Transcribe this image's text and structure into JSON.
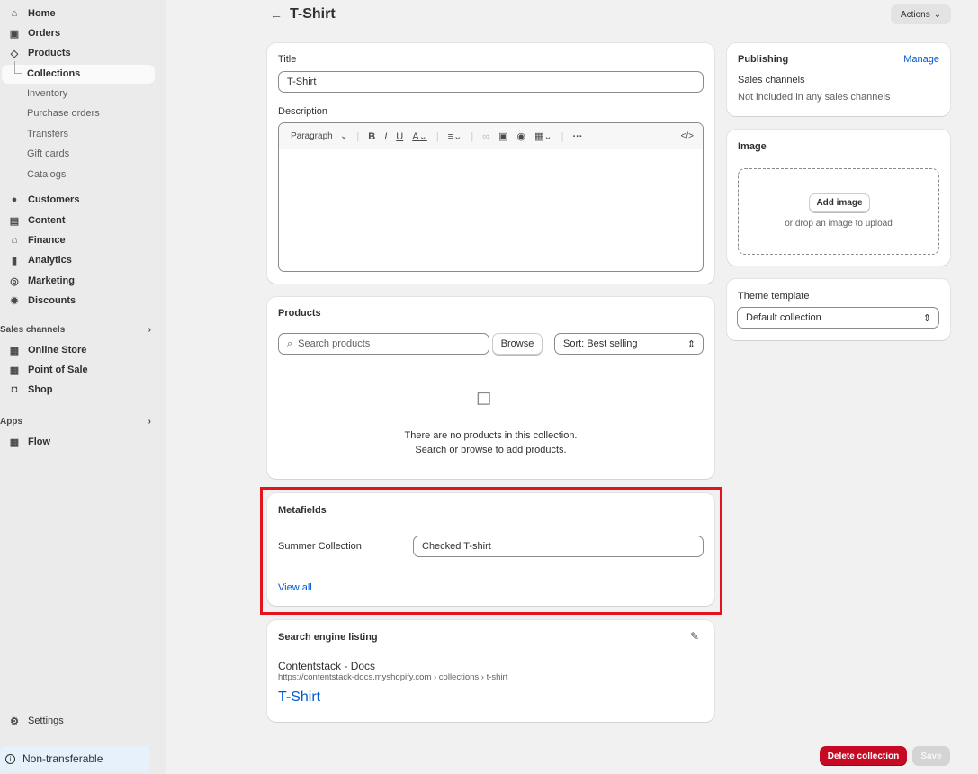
{
  "sidebar": {
    "main": [
      {
        "label": "Home",
        "icon": "home-icon"
      },
      {
        "label": "Orders",
        "icon": "inbox-icon"
      },
      {
        "label": "Products",
        "icon": "tag-icon"
      }
    ],
    "products_sub": [
      {
        "label": "Collections",
        "active": true
      },
      {
        "label": "Inventory"
      },
      {
        "label": "Purchase orders"
      },
      {
        "label": "Transfers"
      },
      {
        "label": "Gift cards"
      },
      {
        "label": "Catalogs"
      }
    ],
    "more": [
      {
        "label": "Customers",
        "icon": "person-icon"
      },
      {
        "label": "Content",
        "icon": "content-icon"
      },
      {
        "label": "Finance",
        "icon": "bank-icon"
      },
      {
        "label": "Analytics",
        "icon": "chart-icon"
      },
      {
        "label": "Marketing",
        "icon": "target-icon"
      },
      {
        "label": "Discounts",
        "icon": "discount-icon"
      }
    ],
    "sales_channels_label": "Sales channels",
    "channels": [
      {
        "label": "Online Store",
        "icon": "store-icon"
      },
      {
        "label": "Point of Sale",
        "icon": "pos-icon"
      },
      {
        "label": "Shop",
        "icon": "shop-icon"
      }
    ],
    "apps_label": "Apps",
    "apps": [
      {
        "label": "Flow",
        "icon": "flow-icon"
      }
    ],
    "settings": "Settings",
    "non_transferable": "Non-transferable"
  },
  "header": {
    "title": "T-Shirt",
    "actions": "Actions"
  },
  "details": {
    "title_label": "Title",
    "title_value": "T-Shirt",
    "description_label": "Description",
    "paragraph": "Paragraph"
  },
  "products": {
    "heading": "Products",
    "search_placeholder": "Search products",
    "browse": "Browse",
    "sort": "Sort: Best selling",
    "empty_line1": "There are no products in this collection.",
    "empty_line2": "Search or browse to add products."
  },
  "metafields": {
    "heading": "Metafields",
    "field_label": "Summer Collection",
    "field_value": "Checked T-shirt",
    "view_all": "View all",
    "highlight_color": "#e3141b"
  },
  "seo": {
    "heading": "Search engine listing",
    "site": "Contentstack - Docs",
    "url": "https://contentstack-docs.myshopify.com › collections › t-shirt",
    "page_title": "T-Shirt"
  },
  "publishing": {
    "heading": "Publishing",
    "manage": "Manage",
    "sales_channels": "Sales channels",
    "status": "Not included in any sales channels"
  },
  "image": {
    "heading": "Image",
    "add": "Add image",
    "hint": "or drop an image to upload"
  },
  "theme": {
    "label": "Theme template",
    "value": "Default collection"
  },
  "footer": {
    "delete": "Delete collection",
    "save": "Save",
    "delete_color": "#c70a24"
  }
}
